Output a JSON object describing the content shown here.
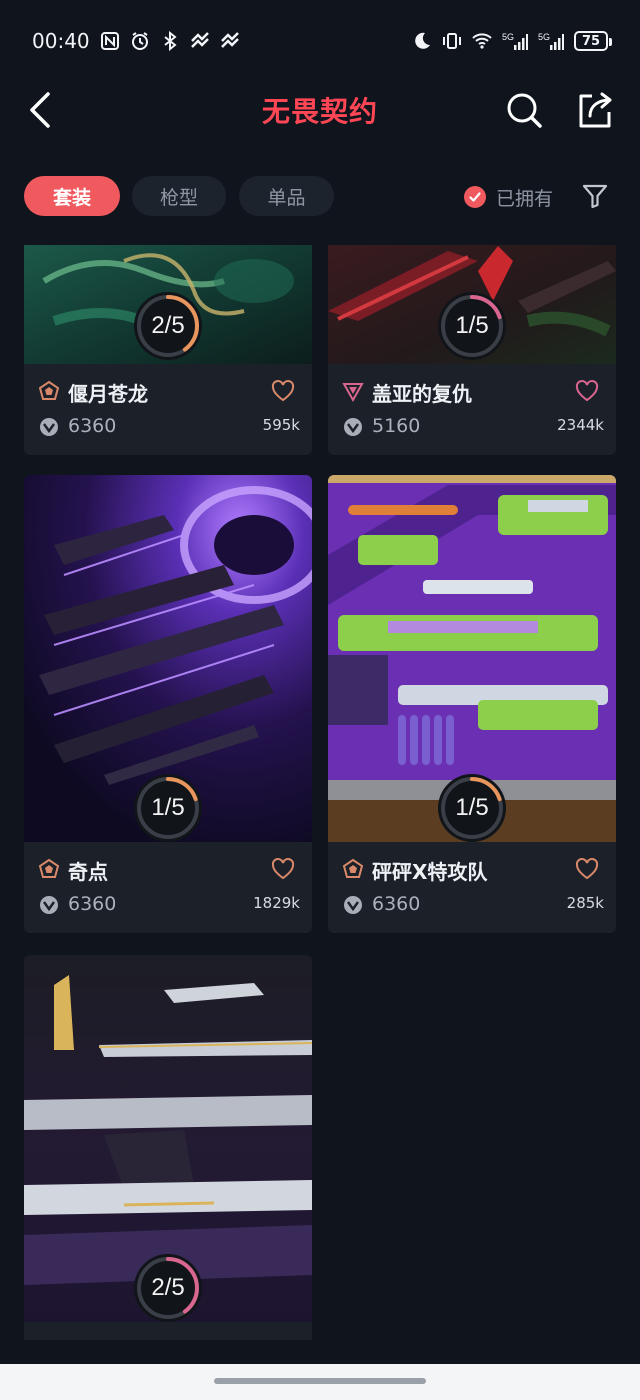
{
  "status_bar": {
    "time": "00:40",
    "battery": "75",
    "icons": [
      "nfc-icon",
      "alarm-icon",
      "bluetooth-icon",
      "sync-icon",
      "moon-icon",
      "vibrate-icon",
      "wifi-icon",
      "signal-5g-icon",
      "signal-5g-icon",
      "battery-icon"
    ]
  },
  "header": {
    "title": "无畏契约",
    "title_color": "#ff4655",
    "icons": [
      "back-icon",
      "search-icon",
      "share-icon"
    ]
  },
  "filters": {
    "tabs": [
      {
        "label": "套装",
        "active": true
      },
      {
        "label": "枪型",
        "active": false
      },
      {
        "label": "单品",
        "active": false
      }
    ],
    "owned_label": "已拥有",
    "owned_checked": true,
    "accent": "#f05a5e"
  },
  "cards": [
    {
      "name": "偃月苍龙",
      "price": "6360",
      "count": "595k",
      "progress_label": "2/5",
      "progress": 0.4,
      "tier": "premium",
      "tier_color": "#d9896a",
      "ring_color": "#e8955e"
    },
    {
      "name": "盖亚的复仇",
      "price": "5160",
      "count": "2344k",
      "progress_label": "1/5",
      "progress": 0.2,
      "tier": "exclusive",
      "tier_color": "#d9668f",
      "ring_color": "#d9668f"
    },
    {
      "name": "奇点",
      "price": "6360",
      "count": "1829k",
      "progress_label": "1/5",
      "progress": 0.2,
      "tier": "premium",
      "tier_color": "#d9896a",
      "ring_color": "#e8955e"
    },
    {
      "name": "砰砰X特攻队",
      "price": "6360",
      "count": "285k",
      "progress_label": "1/5",
      "progress": 0.2,
      "tier": "premium",
      "tier_color": "#d9896a",
      "ring_color": "#e8955e"
    },
    {
      "name": "",
      "price": "",
      "count": "",
      "progress_label": "2/5",
      "progress": 0.4,
      "tier": "exclusive",
      "tier_color": "#d9668f",
      "ring_color": "#d9668f"
    }
  ]
}
